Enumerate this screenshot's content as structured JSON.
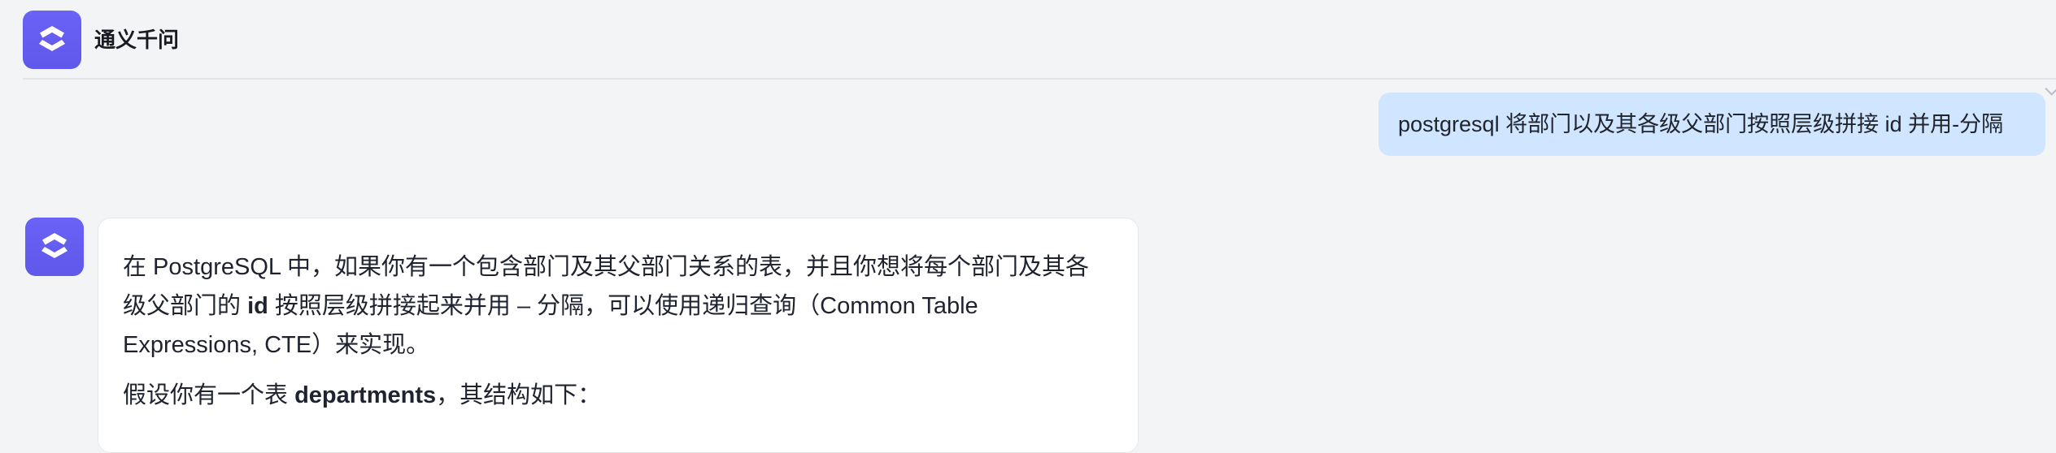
{
  "app": {
    "title": "通义千问",
    "logo_icon": "qwen-logo-icon",
    "accent": "#6560f2"
  },
  "conversation": {
    "user_message": "postgresql 将部门以及其各级父部门按照层级拼接 id 并用-分隔",
    "assistant": {
      "avatar_icon": "qwen-avatar-icon",
      "paragraph_1": {
        "lead": "在 PostgreSQL 中，如果你有一个包含部门及其父部门关系的表，并且你想将每个部门及其各级父部门的 ",
        "strong": "id",
        "tail": " 按照层级拼接起来并用 – 分隔，可以使用递归查询（Common Table Expressions, CTE）来实现。"
      },
      "paragraph_2": {
        "lead": "假设你有一个表 ",
        "strong": "departments",
        "tail": "，其结构如下："
      }
    }
  },
  "colors": {
    "background": "#f3f4f6",
    "user_bubble": "#d0e5ff",
    "assistant_card": "#ffffff",
    "divider": "#e3e5ea"
  }
}
